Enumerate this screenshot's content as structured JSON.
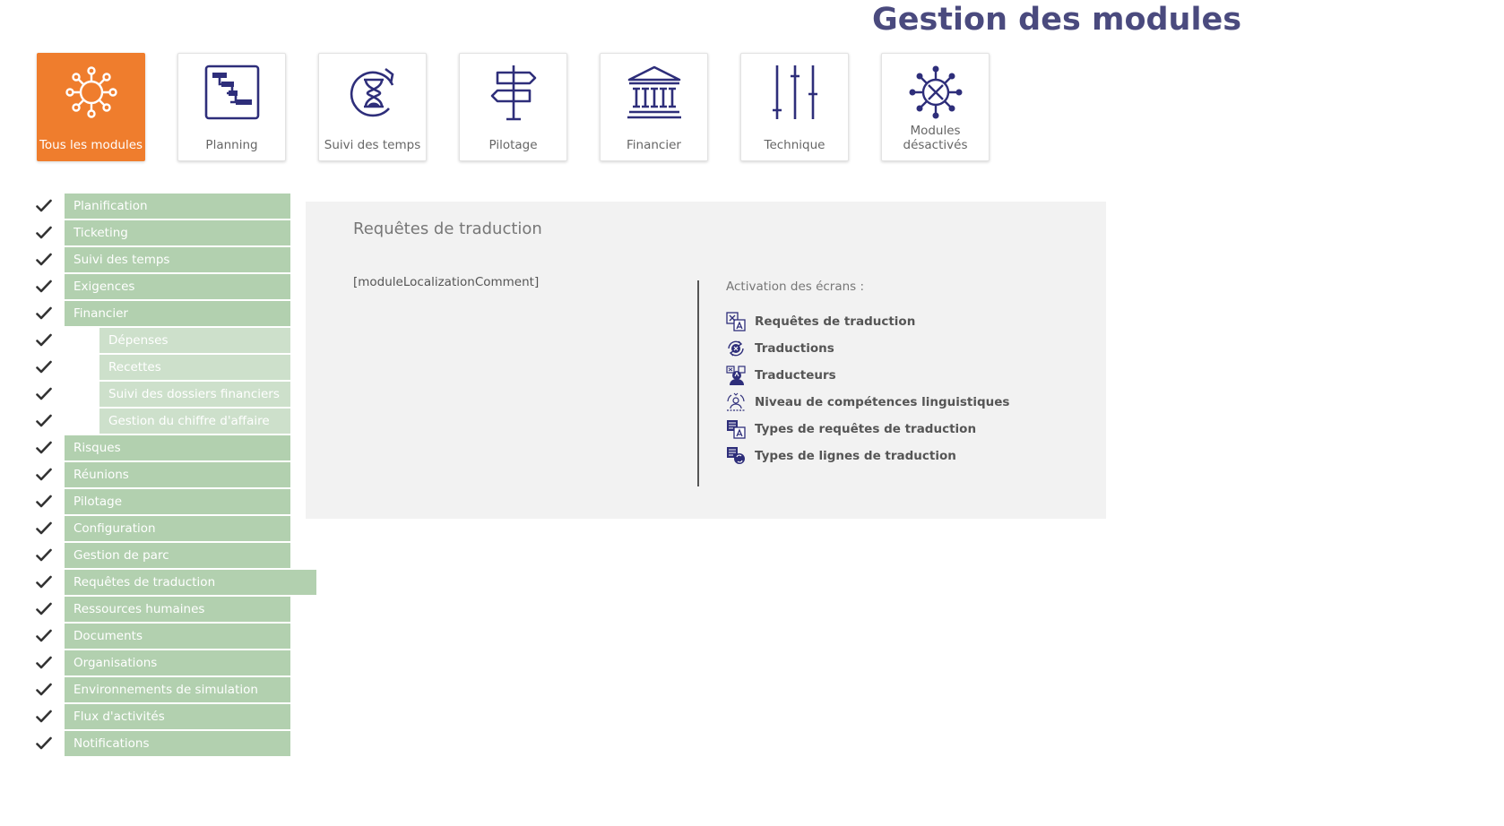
{
  "page": {
    "title": "Gestion des modules"
  },
  "colors": {
    "accent": "#ef7d2d",
    "icon": "#2e2e7a",
    "module_item": "#b2d0af",
    "module_subitem": "#cde0cb",
    "title": "#4a4a7e"
  },
  "tiles": [
    {
      "label": "Tous les modules",
      "icon": "network-icon",
      "active": true
    },
    {
      "label": "Planning",
      "icon": "gantt-icon",
      "active": false
    },
    {
      "label": "Suivi des temps",
      "icon": "hourglass-refresh-icon",
      "active": false
    },
    {
      "label": "Pilotage",
      "icon": "signpost-icon",
      "active": false
    },
    {
      "label": "Financier",
      "icon": "bank-icon",
      "active": false
    },
    {
      "label": "Technique",
      "icon": "sliders-icon",
      "active": false
    },
    {
      "label": "Modules désactivés",
      "label_line1": "Modules",
      "label_line2": "désactivés",
      "icon": "network-disabled-icon",
      "active": false
    }
  ],
  "modules": [
    {
      "label": "Planification",
      "checked": true,
      "sub": false,
      "selected": false
    },
    {
      "label": "Ticketing",
      "checked": true,
      "sub": false,
      "selected": false
    },
    {
      "label": "Suivi des temps",
      "checked": true,
      "sub": false,
      "selected": false
    },
    {
      "label": "Exigences",
      "checked": true,
      "sub": false,
      "selected": false
    },
    {
      "label": "Financier",
      "checked": true,
      "sub": false,
      "selected": false
    },
    {
      "label": "Dépenses",
      "checked": true,
      "sub": true,
      "selected": false
    },
    {
      "label": "Recettes",
      "checked": true,
      "sub": true,
      "selected": false
    },
    {
      "label": "Suivi des dossiers financiers",
      "checked": true,
      "sub": true,
      "selected": false
    },
    {
      "label": "Gestion du chiffre d'affaire",
      "checked": true,
      "sub": true,
      "selected": false
    },
    {
      "label": "Risques",
      "checked": true,
      "sub": false,
      "selected": false
    },
    {
      "label": "Réunions",
      "checked": true,
      "sub": false,
      "selected": false
    },
    {
      "label": "Pilotage",
      "checked": true,
      "sub": false,
      "selected": false
    },
    {
      "label": "Configuration",
      "checked": true,
      "sub": false,
      "selected": false
    },
    {
      "label": "Gestion de parc",
      "checked": true,
      "sub": false,
      "selected": false
    },
    {
      "label": "Requêtes de traduction",
      "checked": true,
      "sub": false,
      "selected": true
    },
    {
      "label": "Ressources humaines",
      "checked": true,
      "sub": false,
      "selected": false
    },
    {
      "label": "Documents",
      "checked": true,
      "sub": false,
      "selected": false
    },
    {
      "label": "Organisations",
      "checked": true,
      "sub": false,
      "selected": false
    },
    {
      "label": "Environnements de simulation",
      "checked": true,
      "sub": false,
      "selected": false
    },
    {
      "label": "Flux d'activités",
      "checked": true,
      "sub": false,
      "selected": false
    },
    {
      "label": "Notifications",
      "checked": true,
      "sub": false,
      "selected": false
    }
  ],
  "detail": {
    "title": "Requêtes de traduction",
    "comment": "[moduleLocalizationComment]",
    "screens_label": "Activation des écrans :",
    "screens": [
      {
        "label": "Requêtes de traduction",
        "icon": "translate-request-icon"
      },
      {
        "label": "Traductions",
        "icon": "translation-icon"
      },
      {
        "label": "Traducteurs",
        "icon": "translator-icon"
      },
      {
        "label": "Niveau de compétences linguistiques",
        "icon": "language-skill-icon"
      },
      {
        "label": "Types de requêtes de traduction",
        "icon": "translate-request-type-icon"
      },
      {
        "label": "Types de lignes de traduction",
        "icon": "translate-line-type-icon"
      }
    ]
  }
}
